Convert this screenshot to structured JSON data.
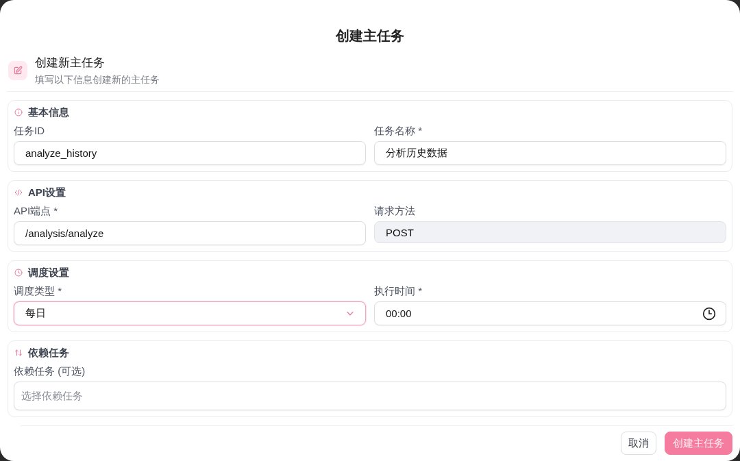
{
  "dialog": {
    "title": "创建主任务"
  },
  "header": {
    "title": "创建新主任务",
    "subtitle": "填写以下信息创建新的主任务"
  },
  "sections": [
    {
      "title": "基本信息",
      "fields": [
        {
          "kind": "text",
          "label": "任务ID",
          "value": "analyze_history",
          "focused": false,
          "disabled": false
        },
        {
          "kind": "text",
          "label": "任务名称 *",
          "value": "分析历史数据",
          "focused": false,
          "disabled": false
        }
      ]
    },
    {
      "title": "API设置",
      "fields": [
        {
          "kind": "text",
          "label": "API端点 *",
          "value": "/analysis/analyze",
          "focused": false,
          "disabled": false
        },
        {
          "kind": "text",
          "label": "请求方法",
          "value": "POST",
          "focused": false,
          "disabled": true
        }
      ]
    },
    {
      "title": "调度设置",
      "fields": [
        {
          "kind": "select",
          "label": "调度类型 *",
          "value": "每日",
          "focused": true,
          "disabled": false
        },
        {
          "kind": "time",
          "label": "执行时间 *",
          "value": "00:00",
          "focused": false,
          "disabled": false
        }
      ]
    },
    {
      "title": "依赖任务",
      "fields": [
        {
          "kind": "text",
          "label": "依赖任务 (可选)",
          "placeholder": "选择依赖任务",
          "focused": false,
          "disabled": false
        }
      ]
    }
  ],
  "buttons": [
    {
      "kind": "secondary",
      "label": "取消"
    },
    {
      "kind": "primary",
      "label": "创建主任务"
    }
  ]
}
